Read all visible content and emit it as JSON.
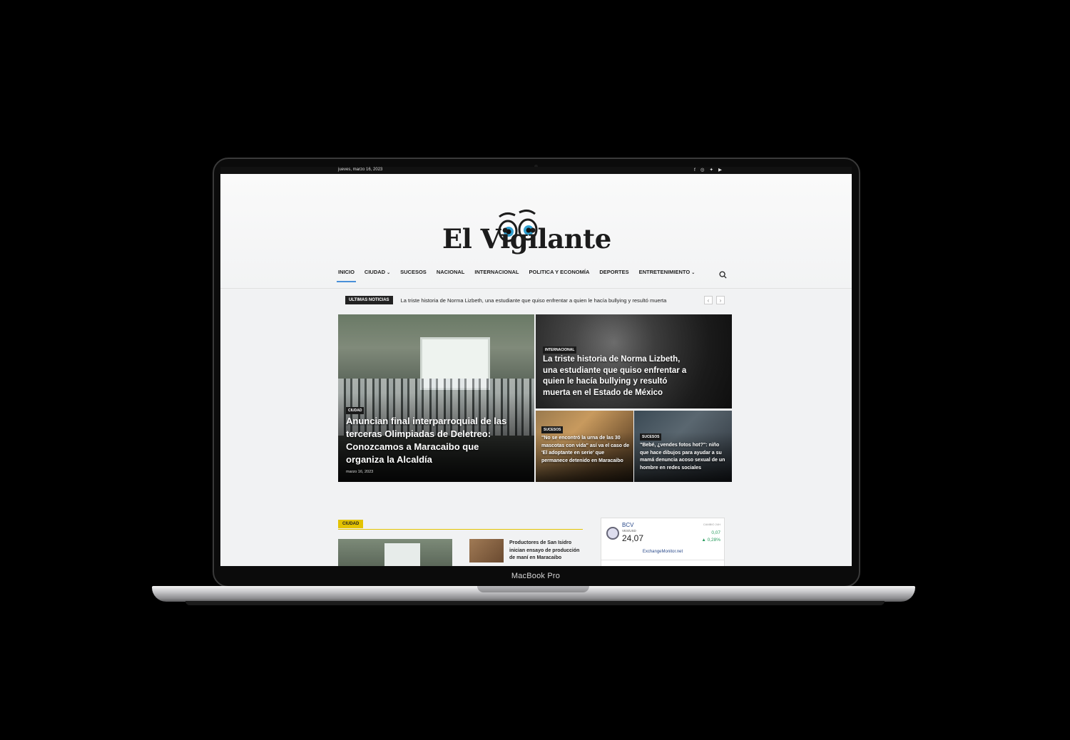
{
  "device": {
    "model_label": "MacBook Pro"
  },
  "site": {
    "topbar": {
      "date": "jueves, marzo 16, 2023",
      "social_icons": [
        "facebook-icon",
        "instagram-icon",
        "twitter-icon",
        "youtube-icon"
      ]
    },
    "logo": "El Vigilante",
    "nav": {
      "items": [
        {
          "label": "INICIO",
          "active": true
        },
        {
          "label": "CIUDAD",
          "dropdown": true
        },
        {
          "label": "SUCESOS"
        },
        {
          "label": "NACIONAL"
        },
        {
          "label": "INTERNACIONAL"
        },
        {
          "label": "POLITICA Y ECONOMÍA"
        },
        {
          "label": "DEPORTES"
        },
        {
          "label": "ENTRETENIMIENTO",
          "dropdown": true
        }
      ]
    },
    "ticker": {
      "badge": "ULTIMAS NOTICIAS",
      "headline": "La triste historia de Norma Lizbeth, una estudiante que quiso enfrentar a quien le hacía bullying y resultó muerta",
      "prev": "‹",
      "next": "›"
    },
    "featured": {
      "main": {
        "category": "CIUDAD",
        "title": "Anuncian final interparroquial de las terceras Olimpiadas de Deletreo: Conozcamos a Maracaibo que organiza la Alcaldía",
        "date": "marzo 16, 2023"
      },
      "top": {
        "category": "INTERNACIONAL",
        "title": "La triste historia de Norma Lizbeth, una estudiante que quiso enfrentar a quien le hacía bullying y resultó muerta en el Estado de México"
      },
      "small1": {
        "category": "SUCESOS",
        "title": "\"No se encontró la urna de las 30 mascotas con vida\" así va el caso de 'El adoptante en serie' que permanece detenido en Maracaibo"
      },
      "small2": {
        "category": "SUCESOS",
        "title": "\"Bebé, ¿vendes fotos hot?\": niño que hace dibujos para ayudar a su mamá denuncia acoso sexual de un hombre en redes sociales"
      }
    },
    "section": {
      "tag": "CIUDAD",
      "mini_title": "Productores de San Isidro inician ensayo de producción de maní en Maracaibo"
    },
    "exchange_widget": {
      "name": "BCV",
      "pair": "VES/USD",
      "rate": "24,07",
      "label": "CAMBIO 24H",
      "change": "0,07",
      "percent": "▲ 0,28%",
      "source": "ExchangeMonitor.net"
    }
  }
}
